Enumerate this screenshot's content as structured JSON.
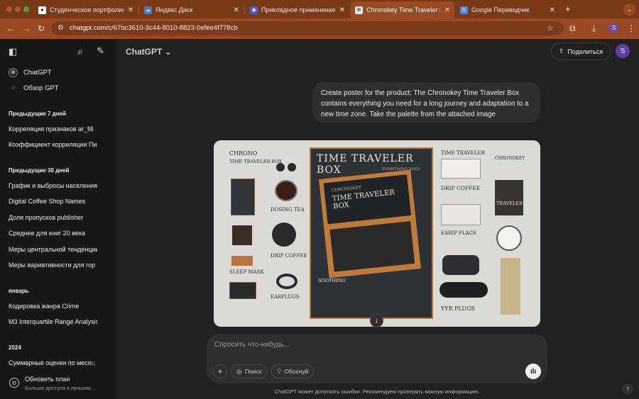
{
  "browser": {
    "tabs": [
      {
        "title": "Студенческое портфолио / Э",
        "icon": "github-icon",
        "color": "#ffffff"
      },
      {
        "title": "Яндекс Диск",
        "icon": "yandex-disk-icon",
        "color": "#3d7bd9"
      },
      {
        "title": "Прикладное применение ге",
        "icon": "page-icon",
        "color": "#3d5fd9"
      },
      {
        "title": "Chronokey Time Traveler Box",
        "icon": "chatgpt-icon",
        "color": "#cfcfcf",
        "active": true
      },
      {
        "title": "Google Переводчик",
        "icon": "google-translate-icon",
        "color": "#4a86e8"
      }
    ],
    "url_host": "chatgpt.com",
    "url_path": "/c/67bc3610-3c44-8010-8823-0efee4f778cb",
    "profile_initial": "S"
  },
  "sidebar": {
    "top_items": [
      {
        "label": "ChatGPT",
        "icon": "chatgpt-logo-icon"
      },
      {
        "label": "Обзор GPT",
        "icon": "grid-icon"
      }
    ],
    "sections": [
      {
        "heading": "Предыдущие 7 дней",
        "items": [
          "Корреляция признаков ar_fill",
          "Коэффициент корреляции Пи"
        ]
      },
      {
        "heading": "Предыдущие 30 дней",
        "items": [
          "График и выбросы населения",
          "Digital Coffee Shop Names",
          "Доля пропусков publisher",
          "Среднее для книг 20 века",
          "Меры центральной тенденции",
          "Меры вариативности для гор"
        ]
      },
      {
        "heading": "январь",
        "items": [
          "Кодировка жанра Crime",
          "M3 Interquartile Range Analysis"
        ]
      },
      {
        "heading": "2024",
        "items": [
          "Суммарные оценки по месяц"
        ]
      }
    ],
    "upgrade": {
      "title": "Обновить план",
      "subtitle": "Больше доступа к лучшим..."
    }
  },
  "header": {
    "model": "ChatGPT",
    "share_label": "Поделиться",
    "user_initial": "S"
  },
  "conversation": {
    "user_message": "Create poster for the product: The Chronokey Time Traveler Box contains everything you need for a long journey and adaptation to a new time zone. Take the palette from the attached image",
    "poster_text": {
      "left_title_1": "CHRONO",
      "left_title_2": "TIME TRAVELER BOX",
      "dosing_tea": "DOSING TEA",
      "drip_coffee": "DRIP COFFEE",
      "sleep_mask": "SLEEP MASK",
      "earplugs": "EARPLUGS",
      "center_title": "TIME TRAVELER BOX",
      "center_sub": "EVERYTHING NEED",
      "center_brand": "CHRONOKEY",
      "center_box": "TIME TRAVELER BOX",
      "soothing": "SOOTHING",
      "right_top": "TIME TRAVELER",
      "right_chronokey": "CHRONOKEY",
      "right_drip": "DRIP COFFEE",
      "right_traveler": "TRAVELER",
      "right_earplugs": "EARIP PLAGS",
      "right_yyr": "YYR PLUGS"
    }
  },
  "composer": {
    "placeholder": "Спросить что-нибудь...",
    "search_label": "Поиск",
    "reason_label": "Обоснуй"
  },
  "footer": {
    "disclaimer": "ChatGPT может допускать ошибки. Рекомендуем проверять важную информацию.",
    "help": "?"
  }
}
